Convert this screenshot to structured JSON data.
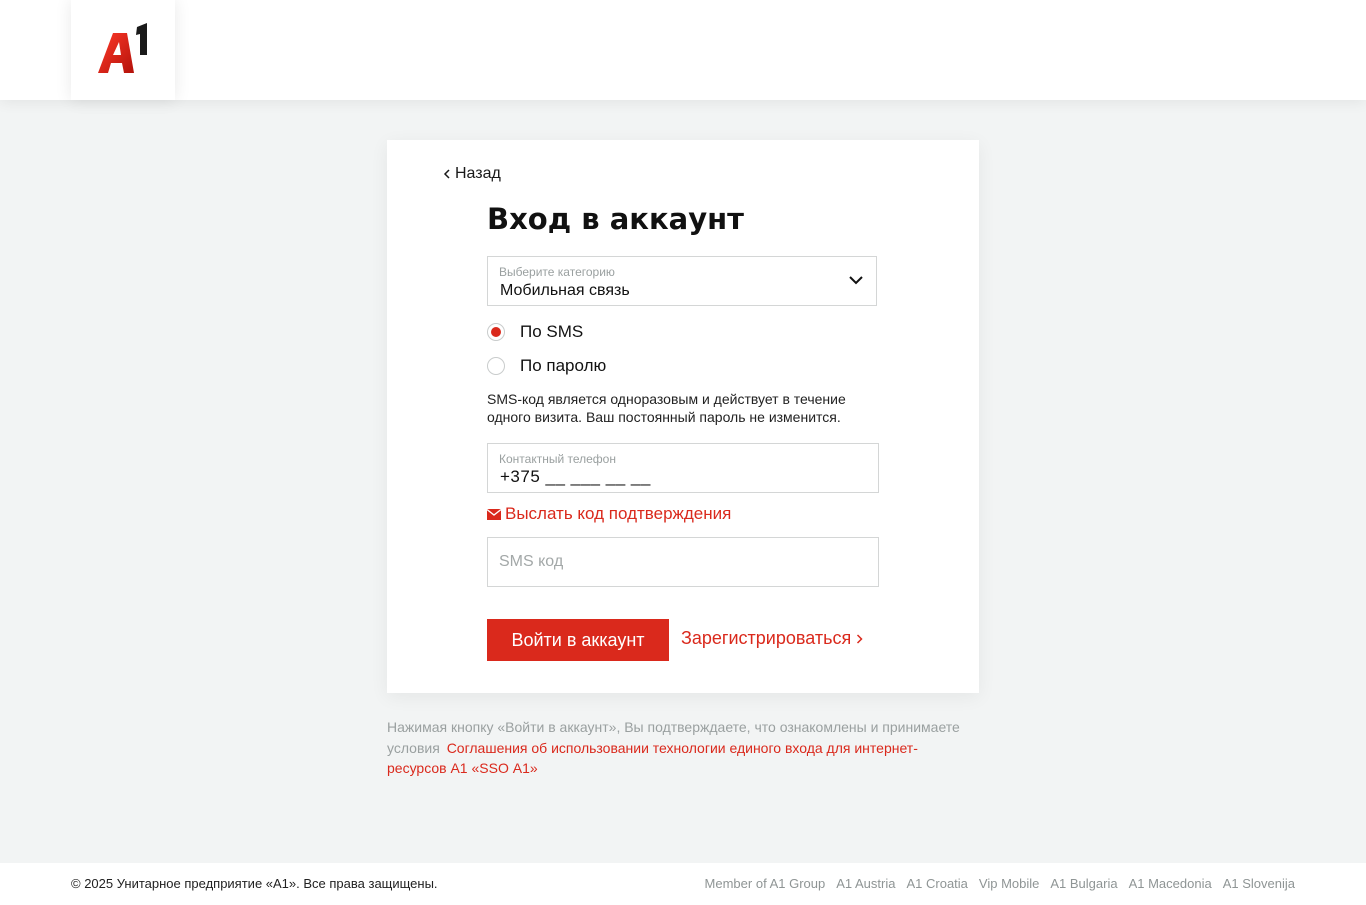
{
  "brand": {
    "logo_text": "A1",
    "accent_color": "#da291c"
  },
  "back": {
    "label": "Назад"
  },
  "login": {
    "title": "Вход в аккаунт",
    "category": {
      "label": "Выберите категорию",
      "value": "Мобильная связь"
    },
    "methods": [
      {
        "label": "По SMS",
        "selected": true
      },
      {
        "label": "По паролю",
        "selected": false
      }
    ],
    "hint": "SMS-код является одноразовым и действует в течение одного визита. Ваш постоянный пароль не изменится.",
    "phone": {
      "label": "Контактный телефон",
      "value": "+375 __ ___ __ __"
    },
    "send_code_label": "Выслать код подтверждения",
    "sms": {
      "placeholder": "SMS код"
    },
    "submit_label": "Войти в аккаунт",
    "register_label": "Зарегистрироваться"
  },
  "agreement": {
    "text": "Нажимая кнопку «Войти в аккаунт», Вы подтверждаете, что ознакомлены и принимаете условия",
    "link": "Соглашения об использовании технологии единого входа для интернет-ресурсов А1 «SSO А1»"
  },
  "footer": {
    "copyright": "© 2025 Унитарное предприятие «А1». Все права защищены.",
    "links": [
      "Member of A1 Group",
      "A1 Austria",
      "A1 Croatia",
      "Vip Mobile",
      "A1 Bulgaria",
      "A1 Macedonia",
      "A1 Slovenija"
    ]
  }
}
